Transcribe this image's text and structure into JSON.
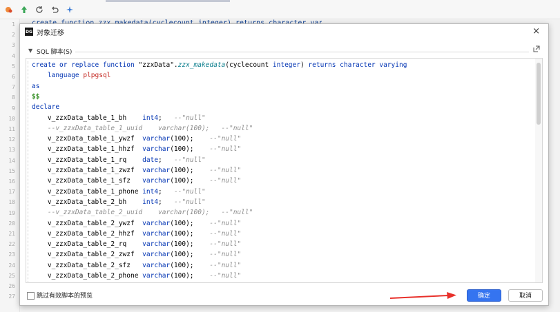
{
  "bg_code": "create function zzx_makedata(cyclecount integer) returns character varying",
  "line_numbers": [
    "1",
    "2",
    "3",
    "4",
    "5",
    "6",
    "7",
    "8",
    "9",
    "10",
    "11",
    "12",
    "13",
    "14",
    "15",
    "16",
    "17",
    "18",
    "19",
    "20",
    "21",
    "22",
    "23",
    "24",
    "25",
    "26",
    "27"
  ],
  "dialog": {
    "title": "对象迁移",
    "app_icon": "DG",
    "close": "×",
    "section_label": "SQL 脚本(S)",
    "checkbox_label": "跳过有效脚本的预览",
    "ok_label": "确定",
    "cancel_label": "取消"
  },
  "code": [
    {
      "segs": [
        [
          "kw",
          "create or replace function "
        ],
        [
          "str",
          "\"zzxData\"."
        ],
        [
          "fn",
          "zzx_makedata"
        ],
        [
          "str",
          "(cyclecount "
        ],
        [
          "kw",
          "integer"
        ],
        [
          "str",
          ") "
        ],
        [
          "kw",
          "returns character varying"
        ]
      ]
    },
    {
      "segs": [
        [
          "kw",
          "    language "
        ],
        [
          "lang",
          "plpgsql"
        ]
      ]
    },
    {
      "segs": [
        [
          "kw",
          "as"
        ]
      ]
    },
    {
      "segs": [
        [
          "dollar",
          "$$"
        ]
      ]
    },
    {
      "segs": [
        [
          "kw",
          "declare"
        ]
      ]
    },
    {
      "segs": [
        [
          "str",
          "    v_zzxData_table_1_bh    "
        ],
        [
          "kw",
          "int4"
        ],
        [
          "str",
          ";   "
        ],
        [
          "cm",
          "--\"null\""
        ]
      ]
    },
    {
      "segs": [
        [
          "cm",
          "    --v_zzxData_table_1_uuid    varchar(100);   --\"null\""
        ]
      ]
    },
    {
      "segs": [
        [
          "str",
          "    v_zzxData_table_1_ywzf  "
        ],
        [
          "kw",
          "varchar"
        ],
        [
          "str",
          "(100);    "
        ],
        [
          "cm",
          "--\"null\""
        ]
      ]
    },
    {
      "segs": [
        [
          "str",
          "    v_zzxData_table_1_hhzf  "
        ],
        [
          "kw",
          "varchar"
        ],
        [
          "str",
          "(100);    "
        ],
        [
          "cm",
          "--\"null\""
        ]
      ]
    },
    {
      "segs": [
        [
          "str",
          "    v_zzxData_table_1_rq    "
        ],
        [
          "kw",
          "date"
        ],
        [
          "str",
          ";   "
        ],
        [
          "cm",
          "--\"null\""
        ]
      ]
    },
    {
      "segs": [
        [
          "str",
          "    v_zzxData_table_1_zwzf  "
        ],
        [
          "kw",
          "varchar"
        ],
        [
          "str",
          "(100);    "
        ],
        [
          "cm",
          "--\"null\""
        ]
      ]
    },
    {
      "segs": [
        [
          "str",
          "    v_zzxData_table_1_sfz   "
        ],
        [
          "kw",
          "varchar"
        ],
        [
          "str",
          "(100);    "
        ],
        [
          "cm",
          "--\"null\""
        ]
      ]
    },
    {
      "segs": [
        [
          "str",
          "    v_zzxData_table_1_phone "
        ],
        [
          "kw",
          "int4"
        ],
        [
          "str",
          ";   "
        ],
        [
          "cm",
          "--\"null\""
        ]
      ]
    },
    {
      "segs": [
        [
          "str",
          "    v_zzxData_table_2_bh    "
        ],
        [
          "kw",
          "int4"
        ],
        [
          "str",
          ";   "
        ],
        [
          "cm",
          "--\"null\""
        ]
      ]
    },
    {
      "segs": [
        [
          "cm",
          "    --v_zzxData_table_2_uuid    varchar(100);   --\"null\""
        ]
      ]
    },
    {
      "segs": [
        [
          "str",
          "    v_zzxData_table_2_ywzf  "
        ],
        [
          "kw",
          "varchar"
        ],
        [
          "str",
          "(100);    "
        ],
        [
          "cm",
          "--\"null\""
        ]
      ]
    },
    {
      "segs": [
        [
          "str",
          "    v_zzxData_table_2_hhzf  "
        ],
        [
          "kw",
          "varchar"
        ],
        [
          "str",
          "(100);    "
        ],
        [
          "cm",
          "--\"null\""
        ]
      ]
    },
    {
      "segs": [
        [
          "str",
          "    v_zzxData_table_2_rq    "
        ],
        [
          "kw",
          "varchar"
        ],
        [
          "str",
          "(100);    "
        ],
        [
          "cm",
          "--\"null\""
        ]
      ]
    },
    {
      "segs": [
        [
          "str",
          "    v_zzxData_table_2_zwzf  "
        ],
        [
          "kw",
          "varchar"
        ],
        [
          "str",
          "(100);    "
        ],
        [
          "cm",
          "--\"null\""
        ]
      ]
    },
    {
      "segs": [
        [
          "str",
          "    v_zzxData_table_2_sfz   "
        ],
        [
          "kw",
          "varchar"
        ],
        [
          "str",
          "(100);    "
        ],
        [
          "cm",
          "--\"null\""
        ]
      ]
    },
    {
      "segs": [
        [
          "str",
          "    v_zzxData_table_2_phone "
        ],
        [
          "kw",
          "varchar"
        ],
        [
          "str",
          "(100);    "
        ],
        [
          "cm",
          "--\"null\""
        ]
      ]
    }
  ],
  "colors": {
    "accent": "#3574f0",
    "keyword": "#0033b3",
    "comment": "#8c8c8c",
    "arrow": "#e8302a"
  }
}
